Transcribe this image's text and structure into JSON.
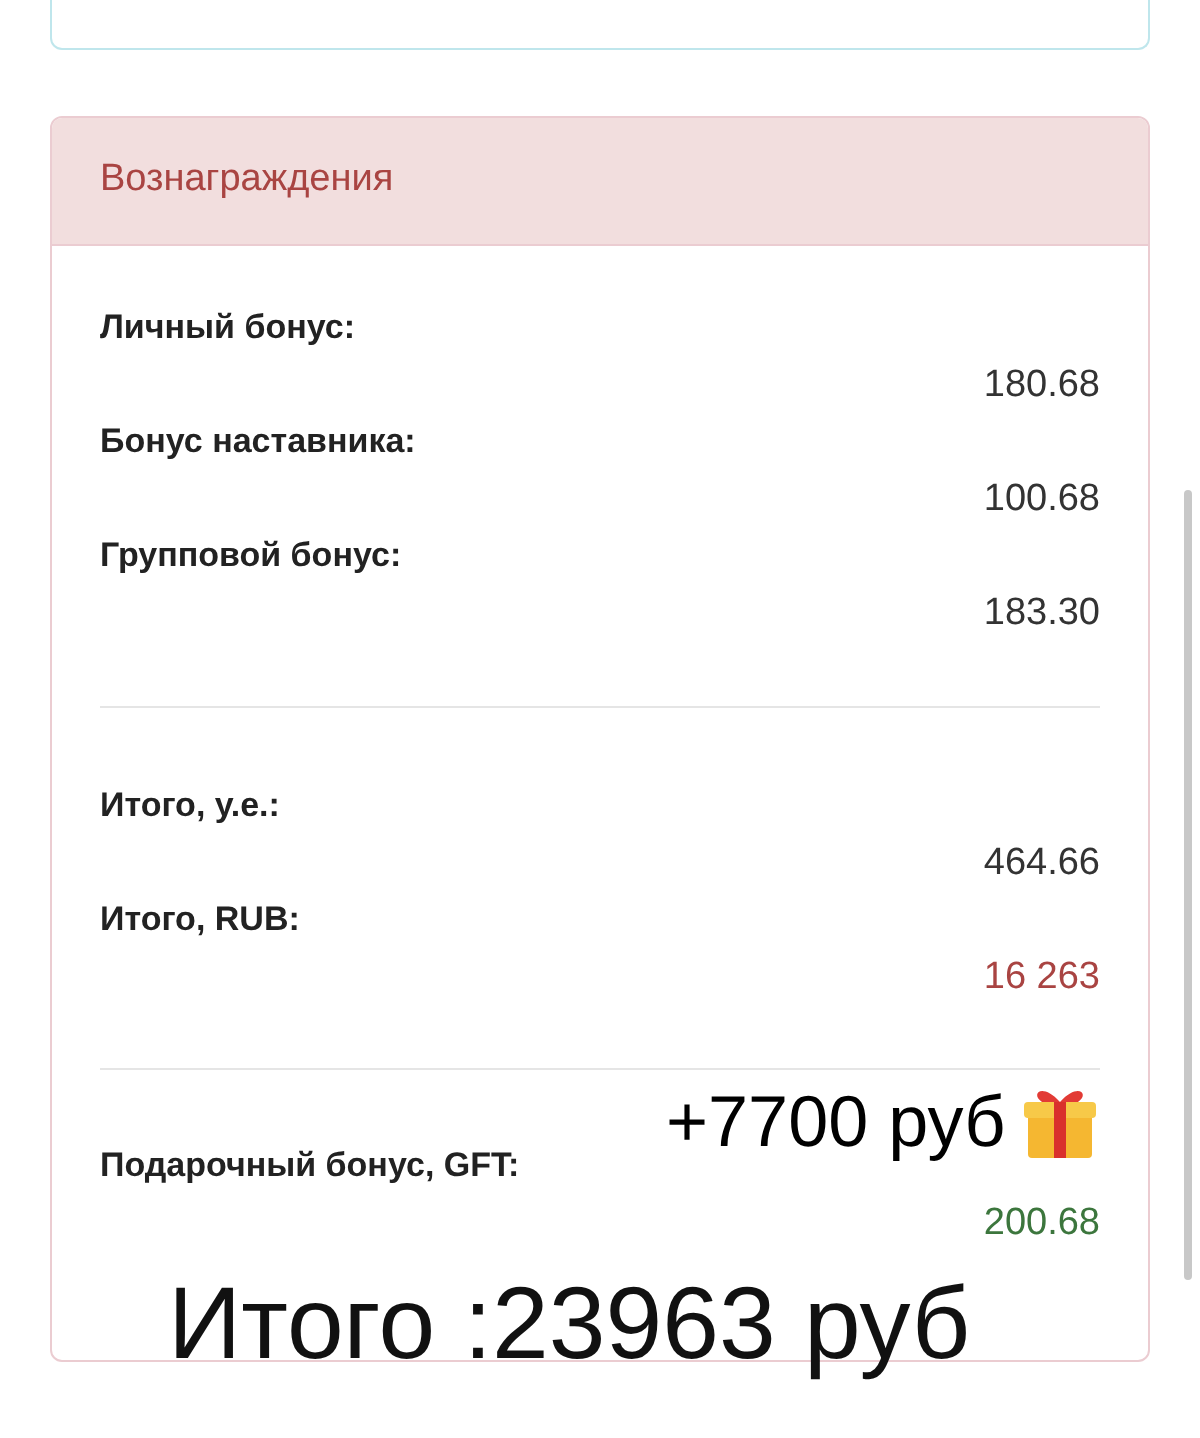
{
  "rewards": {
    "title": "Вознаграждения",
    "groups": [
      {
        "rows": [
          {
            "label": "Личный бонус:",
            "value": "180.68",
            "color": "#333333"
          },
          {
            "label": "Бонус наставника:",
            "value": "100.68",
            "color": "#333333"
          },
          {
            "label": "Групповой бонус:",
            "value": "183.30",
            "color": "#333333"
          }
        ]
      },
      {
        "rows": [
          {
            "label": "Итого, у.е.:",
            "value": "464.66",
            "color": "#333333"
          },
          {
            "label": "Итого, RUB:",
            "value": "16 263",
            "color": "#a94442"
          }
        ]
      },
      {
        "rows": [
          {
            "label": "Подарочный бонус, GFT:",
            "value": "200.68",
            "color": "#3c763d"
          }
        ]
      }
    ]
  },
  "overlays": {
    "bonus_note": "+7700 руб",
    "total_note": "Итого :23963 руб"
  }
}
